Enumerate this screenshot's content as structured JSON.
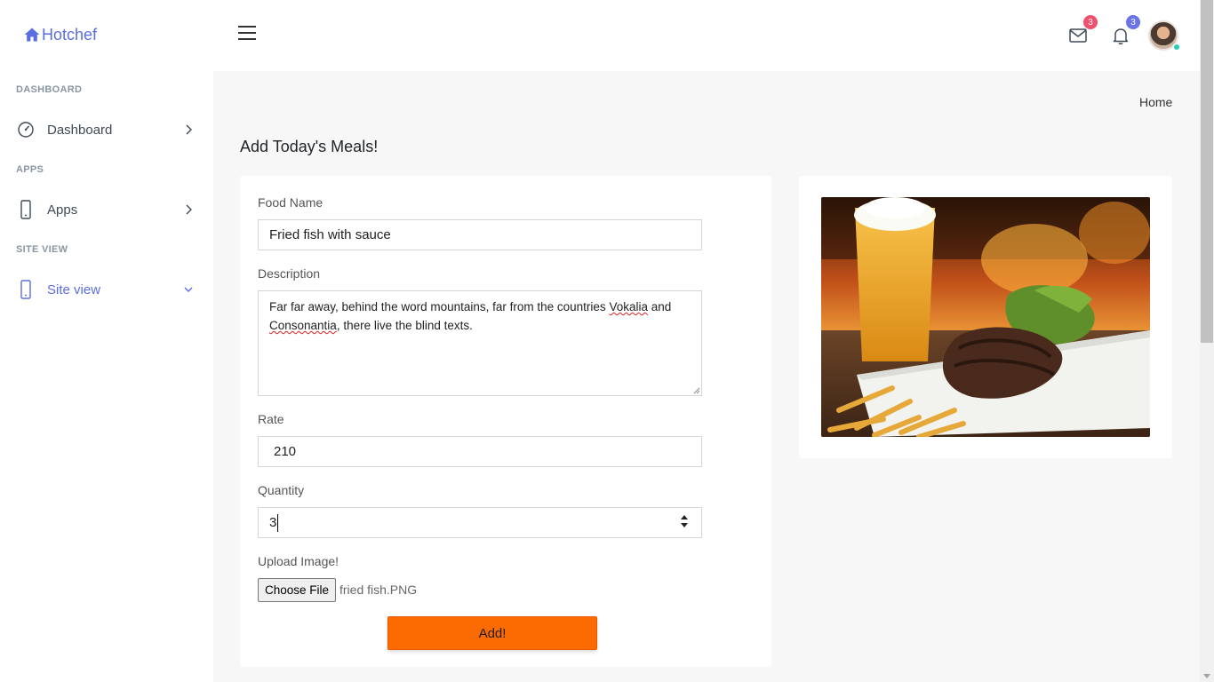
{
  "brand": {
    "name": "Hotchef",
    "color": "#5b6ee1",
    "icon": "home-icon"
  },
  "sidebar": {
    "sections": [
      {
        "title": "DASHBOARD",
        "item": {
          "label": "Dashboard",
          "icon": "gauge-icon",
          "chevron": "chevron-right-icon"
        }
      },
      {
        "title": "APPS",
        "item": {
          "label": "Apps",
          "icon": "mobile-icon",
          "chevron": "chevron-right-icon"
        }
      },
      {
        "title": "SITE VIEW",
        "item": {
          "label": "Site view",
          "icon": "mobile-icon",
          "chevron": "chevron-down-icon",
          "active": true
        }
      }
    ]
  },
  "topbar": {
    "messages": {
      "icon": "envelope-icon",
      "count": "3",
      "badge_color": "#f0506e"
    },
    "notifications": {
      "icon": "bell-icon",
      "count": "3",
      "badge_color": "#6a73e8"
    },
    "avatar": {
      "status_color": "#25d0b5"
    }
  },
  "breadcrumb": {
    "current": "Home"
  },
  "page": {
    "title": "Add Today's Meals!"
  },
  "form": {
    "food_name": {
      "label": "Food Name",
      "value": "Fried fish with sauce"
    },
    "description": {
      "label": "Description",
      "text_part1": "Far far away, behind the word mountains, far from the countries ",
      "misspelled1": "Vokalia",
      "text_part2": " and ",
      "misspelled2": "Consonantia",
      "text_part3": ", there live the blind texts."
    },
    "rate": {
      "label": "Rate",
      "value": "210"
    },
    "quantity": {
      "label": "Quantity",
      "value": "3"
    },
    "upload": {
      "label": "Upload Image!",
      "button_label": "Choose File",
      "file_name": "fried fish.PNG"
    },
    "submit_label": "Add!",
    "accent_color": "#fb6b02"
  }
}
